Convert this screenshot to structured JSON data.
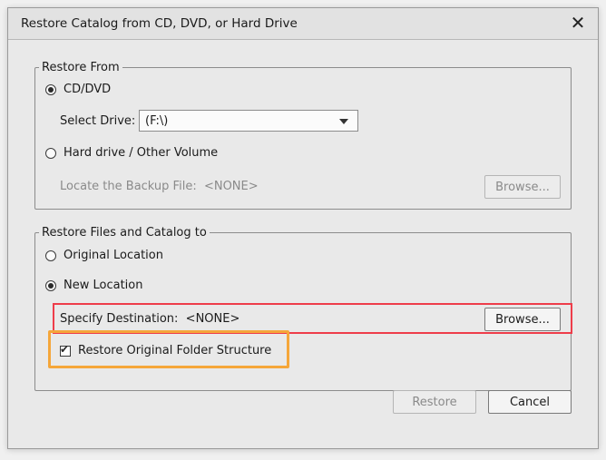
{
  "dialog": {
    "title": "Restore Catalog from CD, DVD, or Hard Drive",
    "close_glyph": "✕"
  },
  "restore_from": {
    "legend": "Restore From",
    "cd_dvd_label": "CD/DVD",
    "cd_dvd_selected": true,
    "select_drive_label": "Select Drive:",
    "drive_value": "(F:\\)",
    "hard_drive_label": "Hard drive / Other Volume",
    "hard_drive_selected": false,
    "locate_backup_text": "Locate the Backup File:  <NONE>",
    "browse_label": "Browse..."
  },
  "restore_to": {
    "legend": "Restore Files and Catalog to",
    "original_location_label": "Original Location",
    "original_selected": false,
    "new_location_label": "New Location",
    "new_selected": true,
    "specify_destination_text": "Specify Destination:  <NONE>",
    "browse_label": "Browse...",
    "folder_structure_label": "Restore Original Folder Structure",
    "folder_structure_checked": true
  },
  "footer": {
    "restore_label": "Restore",
    "cancel_label": "Cancel"
  },
  "highlights": {
    "red": "#ee3d4a",
    "orange": "#f5a63a"
  }
}
